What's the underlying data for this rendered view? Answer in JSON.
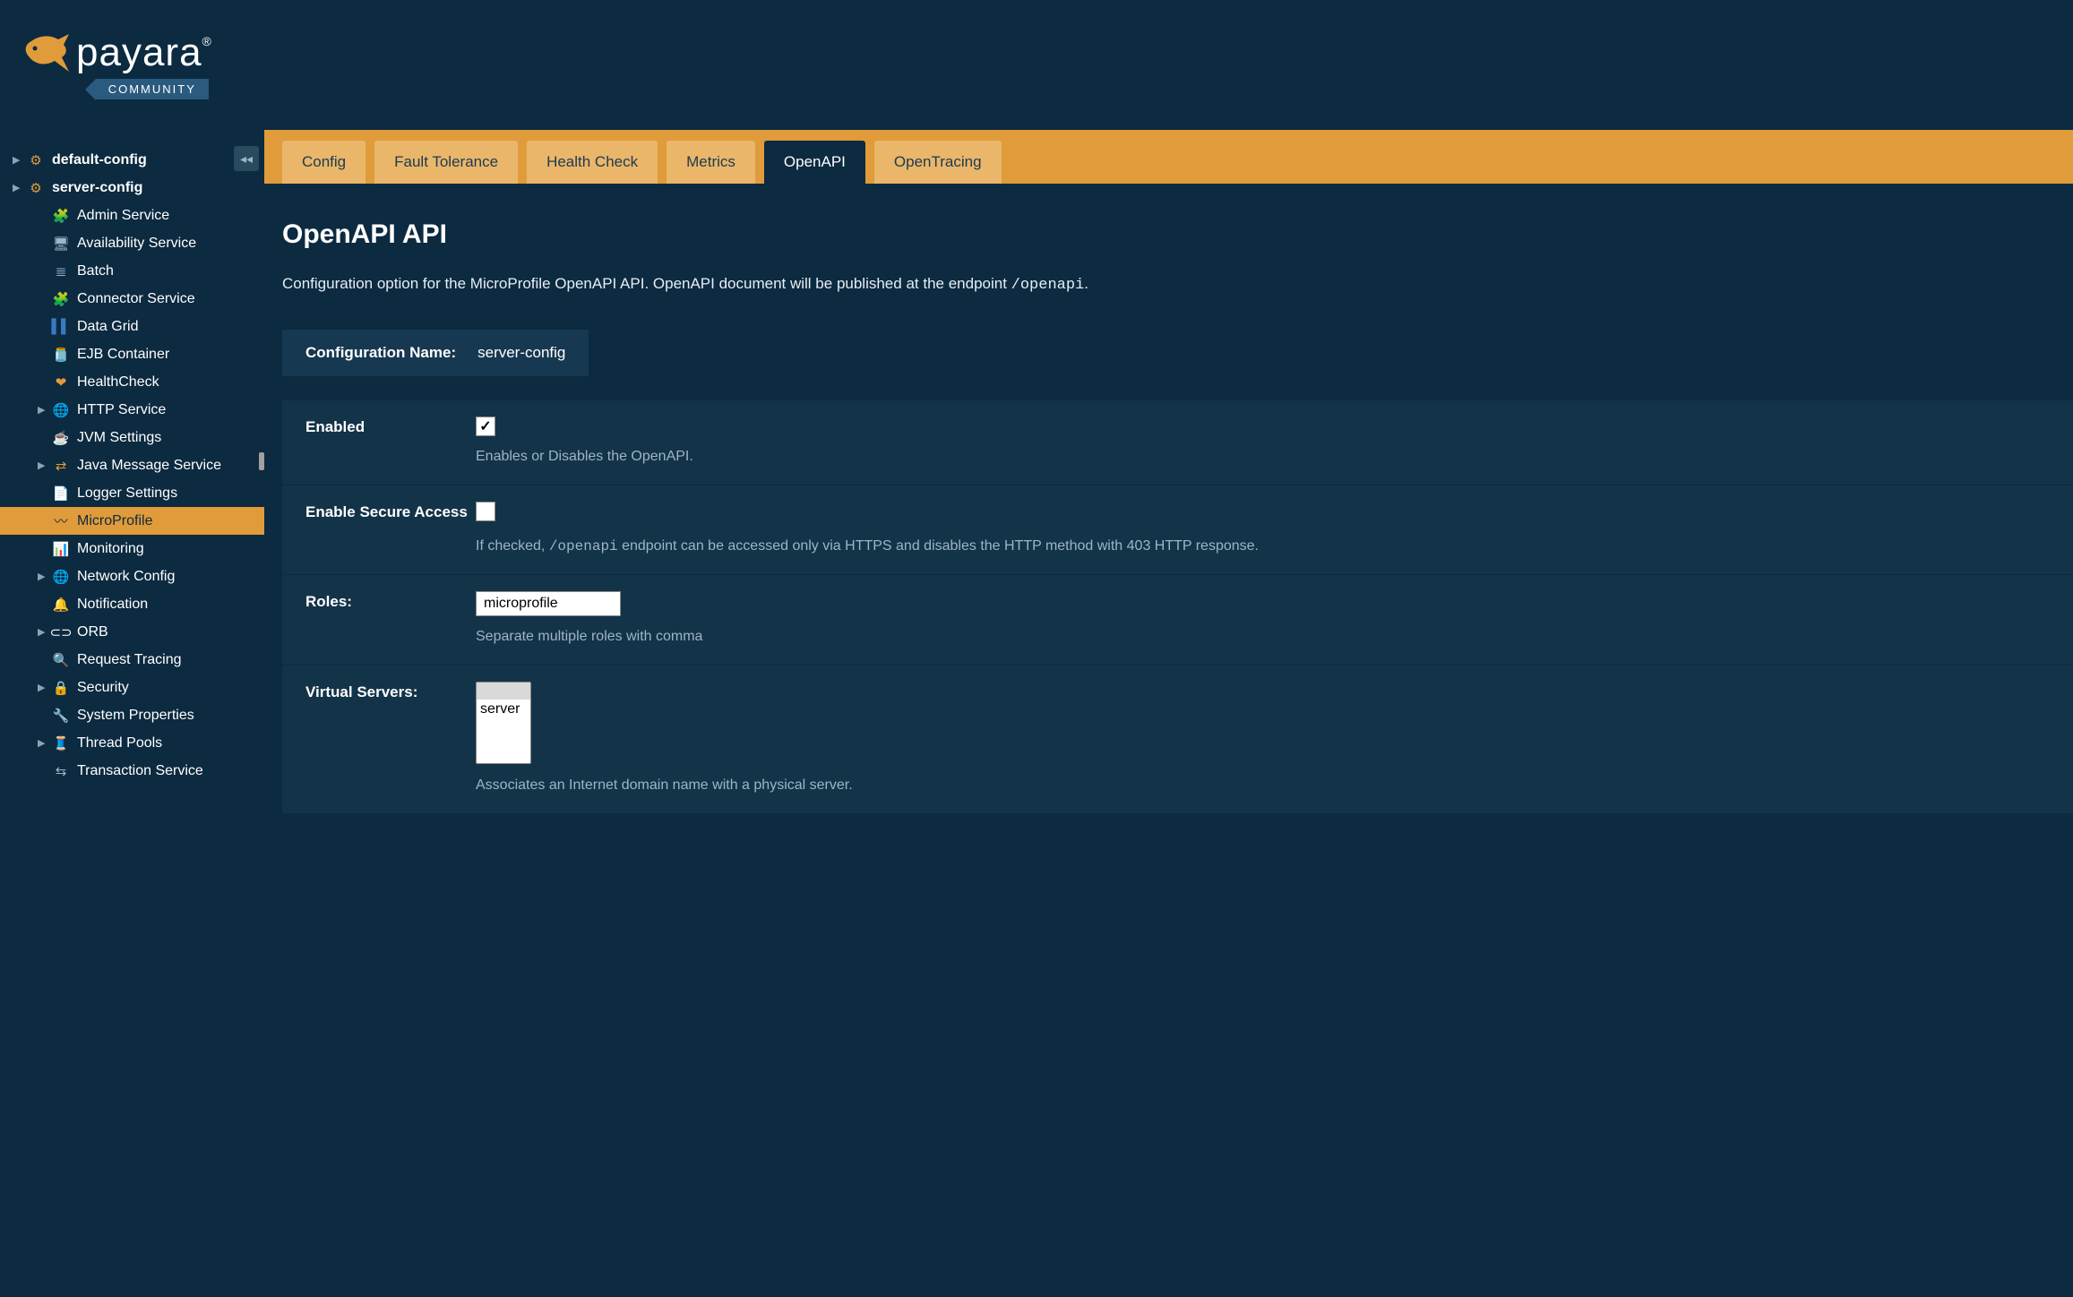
{
  "logo": {
    "name": "payara",
    "badge": "COMMUNITY"
  },
  "sidebar": {
    "roots": [
      {
        "label": "default-config",
        "bold": false
      },
      {
        "label": "server-config",
        "bold": true
      }
    ],
    "items": [
      {
        "label": "Admin Service",
        "icon": "🧩",
        "iconColor": "#e09b3a",
        "expandable": false
      },
      {
        "label": "Availability Service",
        "icon": "🖥",
        "iconColor": "#9db5c6",
        "expandable": false
      },
      {
        "label": "Batch",
        "icon": "≣",
        "iconColor": "#9db5c6",
        "expandable": false
      },
      {
        "label": "Connector Service",
        "icon": "🧩",
        "iconColor": "#e09b3a",
        "expandable": false
      },
      {
        "label": "Data Grid",
        "icon": "▌▌",
        "iconColor": "#3a78c2",
        "expandable": false
      },
      {
        "label": "EJB Container",
        "icon": "🫙",
        "iconColor": "#d6863a",
        "expandable": false
      },
      {
        "label": "HealthCheck",
        "icon": "❤",
        "iconColor": "#e09b3a",
        "expandable": false
      },
      {
        "label": "HTTP Service",
        "icon": "🌐",
        "iconColor": "#3a9be0",
        "expandable": true
      },
      {
        "label": "JVM Settings",
        "icon": "☕",
        "iconColor": "#c9a16a",
        "expandable": false
      },
      {
        "label": "Java Message Service",
        "icon": "⇄",
        "iconColor": "#e09b3a",
        "expandable": true
      },
      {
        "label": "Logger Settings",
        "icon": "📄",
        "iconColor": "#c9a16a",
        "expandable": false
      },
      {
        "label": "MicroProfile",
        "icon": "〰",
        "iconColor": "#0c2a40",
        "expandable": false,
        "selected": true
      },
      {
        "label": "Monitoring",
        "icon": "📊",
        "iconColor": "#3a9be0",
        "expandable": false
      },
      {
        "label": "Network Config",
        "icon": "🌐",
        "iconColor": "#3a9be0",
        "expandable": true
      },
      {
        "label": "Notification",
        "icon": "🔔",
        "iconColor": "#e09b3a",
        "expandable": false
      },
      {
        "label": "ORB",
        "icon": "⊂⊃",
        "iconColor": "#ffffff",
        "expandable": true
      },
      {
        "label": "Request Tracing",
        "icon": "🔍",
        "iconColor": "#e09b3a",
        "expandable": false
      },
      {
        "label": "Security",
        "icon": "🔒",
        "iconColor": "#ffffff",
        "expandable": true
      },
      {
        "label": "System Properties",
        "icon": "🔧",
        "iconColor": "#9db5c6",
        "expandable": false
      },
      {
        "label": "Thread Pools",
        "icon": "🧵",
        "iconColor": "#e09b3a",
        "expandable": true
      },
      {
        "label": "Transaction Service",
        "icon": "⇆",
        "iconColor": "#9db5c6",
        "expandable": false
      }
    ]
  },
  "tabs": [
    {
      "label": "Config"
    },
    {
      "label": "Fault Tolerance"
    },
    {
      "label": "Health Check"
    },
    {
      "label": "Metrics"
    },
    {
      "label": "OpenAPI",
      "active": true
    },
    {
      "label": "OpenTracing"
    }
  ],
  "page": {
    "title": "OpenAPI API",
    "desc_pre": "Configuration option for the MicroProfile OpenAPI API. OpenAPI document will be published at the endpoint ",
    "desc_code": "/openapi",
    "desc_post": "."
  },
  "config": {
    "label": "Configuration Name:",
    "value": "server-config"
  },
  "form": {
    "enabled": {
      "label": "Enabled",
      "checked": true,
      "help": "Enables or Disables the OpenAPI."
    },
    "secure": {
      "label": "Enable Secure Access",
      "checked": false,
      "help_pre": "If checked, ",
      "help_code": "/openapi",
      "help_post": " endpoint can be accessed only via HTTPS and disables the HTTP method with 403 HTTP response."
    },
    "roles": {
      "label": "Roles:",
      "value": "microprofile",
      "help": "Separate multiple roles with comma"
    },
    "vservers": {
      "label": "Virtual Servers:",
      "options": [
        "",
        "server"
      ],
      "help": "Associates an Internet domain name with a physical server."
    }
  }
}
